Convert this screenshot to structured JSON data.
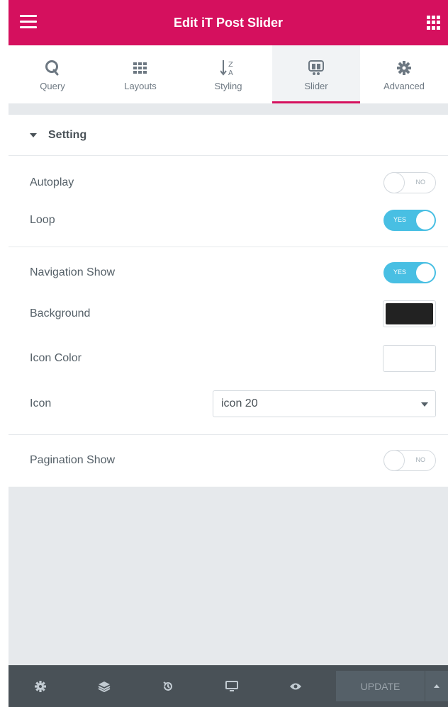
{
  "header": {
    "title": "Edit iT Post Slider"
  },
  "tabs": [
    {
      "label": "Query",
      "icon": "query-icon"
    },
    {
      "label": "Layouts",
      "icon": "grid-icon"
    },
    {
      "label": "Styling",
      "icon": "sort-az-icon"
    },
    {
      "label": "Slider",
      "icon": "slider-icon",
      "active": true
    },
    {
      "label": "Advanced",
      "icon": "gear-icon"
    }
  ],
  "section": {
    "title": "Setting"
  },
  "controls": {
    "autoplay": {
      "label": "Autoplay",
      "state": "NO"
    },
    "loop": {
      "label": "Loop",
      "state": "YES"
    },
    "navigation": {
      "label": "Navigation Show",
      "state": "YES"
    },
    "background": {
      "label": "Background",
      "color": "#222222"
    },
    "icon_color": {
      "label": "Icon Color",
      "color": "#ffffff"
    },
    "icon": {
      "label": "Icon",
      "value": "icon 20"
    },
    "pagination": {
      "label": "Pagination Show",
      "state": "NO"
    }
  },
  "footer": {
    "update_label": "UPDATE"
  },
  "colors": {
    "accent": "#d5105e",
    "toggle_on": "#48bfe3",
    "footer": "#495157"
  }
}
